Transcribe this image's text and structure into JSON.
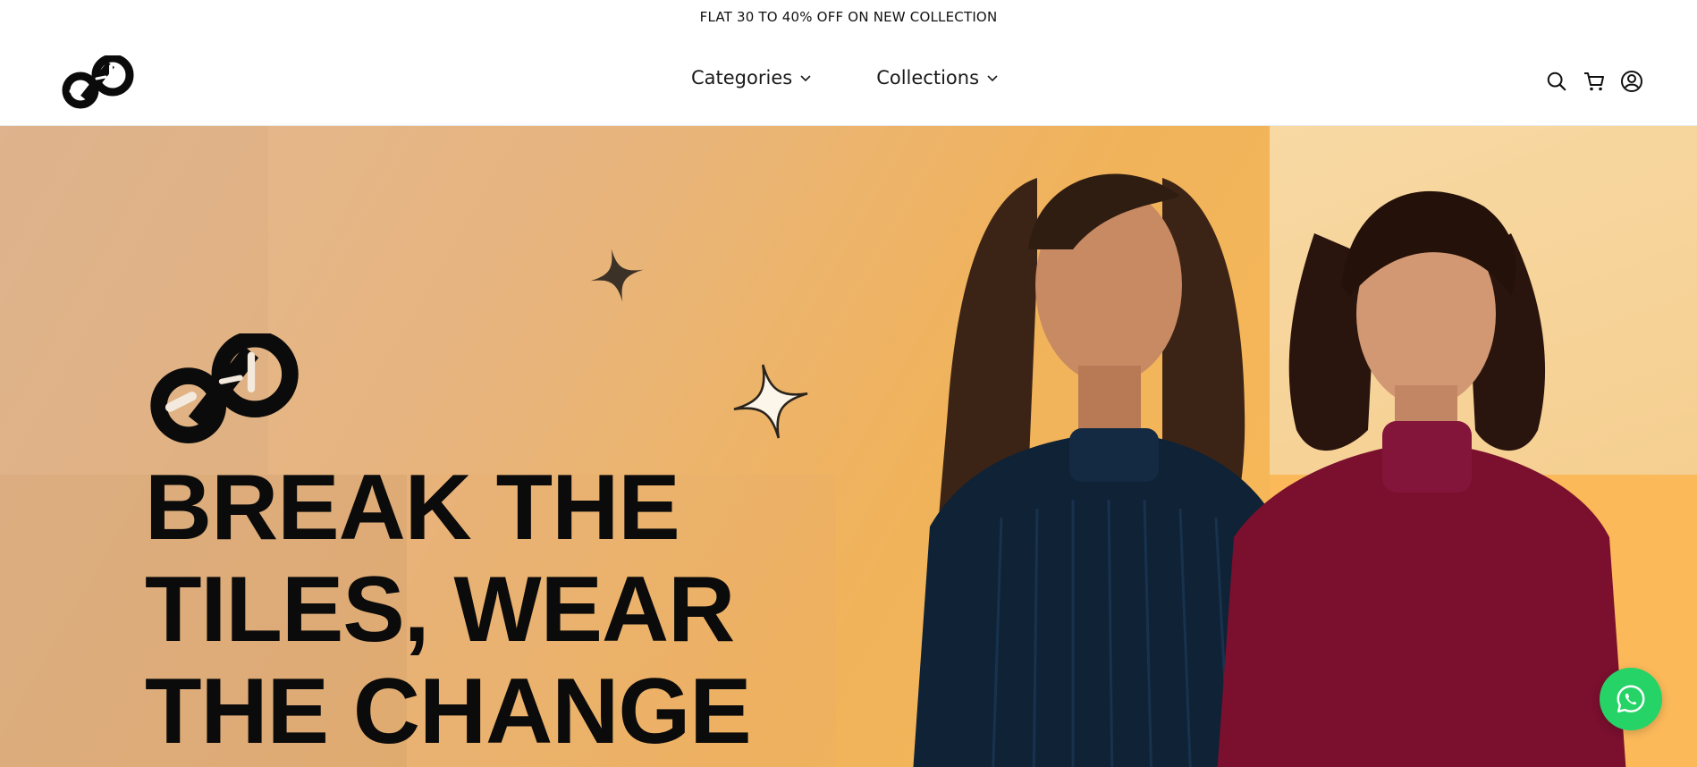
{
  "announcement": {
    "text": "FLAT 30 TO 40% OFF ON NEW COLLECTION"
  },
  "header": {
    "logo_icon": "infinity-link-logo",
    "nav": [
      {
        "label": "Categories",
        "icon": "chevron-down-icon"
      },
      {
        "label": "Collections",
        "icon": "chevron-down-icon"
      }
    ],
    "icons": [
      "search-icon",
      "cart-icon",
      "account-icon"
    ]
  },
  "hero": {
    "headline_lines": [
      "BREAK THE",
      "TILES, WEAR",
      "THE CHANGE"
    ],
    "models": [
      {
        "sweater_color": "#0f2236"
      },
      {
        "sweater_color": "#7a0f2e"
      }
    ],
    "background_colors": [
      "#e2b892",
      "#f1b35a",
      "#f6b858"
    ]
  },
  "whatsapp": {
    "icon": "whatsapp-icon",
    "color": "#25d366"
  }
}
